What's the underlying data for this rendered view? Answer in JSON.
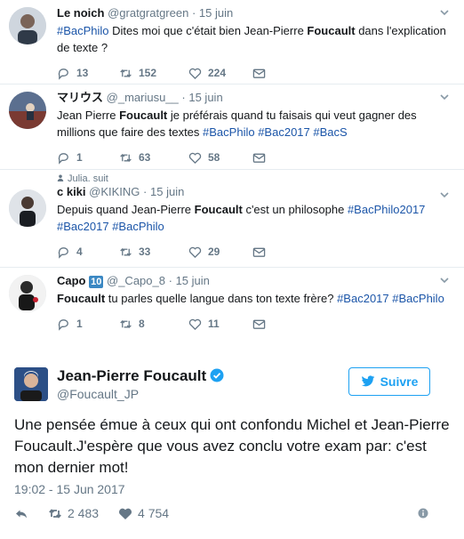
{
  "tweets": [
    {
      "name": "Le noich",
      "handle": "@gratgratgreen",
      "time": "15 juin",
      "text_parts": [
        "#BacPhilo",
        " Dites moi que c'était bien Jean-Pierre ",
        "Foucault",
        " dans l'explication de texte ?"
      ],
      "replies": "13",
      "retweets": "152",
      "likes": "224"
    },
    {
      "name": "マリウス",
      "handle": "@_mariusu__",
      "time": "15 juin",
      "text_parts": [
        "Jean Pierre ",
        "Foucault",
        " je préférais quand tu faisais qui veut gagner des millions que faire des textes ",
        "#BacPhilo",
        " ",
        "#Bac2017",
        " ",
        "#BacS"
      ],
      "replies": "1",
      "retweets": "63",
      "likes": "58"
    },
    {
      "context": "Julia. suit",
      "name": "c kiki",
      "handle": "@KIKING",
      "time": "15 juin",
      "text_parts": [
        "Depuis quand Jean-Pierre ",
        "Foucault",
        " c'est un philosophe ",
        "#BacPhilo2017",
        " ",
        "#Bac2017",
        " ",
        "#BacPhilo"
      ],
      "replies": "4",
      "retweets": "33",
      "likes": "29"
    },
    {
      "name": "Capo",
      "name_badge": "10",
      "handle": "@_Capo_8",
      "time": "15 juin",
      "text_parts": [
        "Foucault",
        " tu parles quelle langue dans ton texte frère? ",
        "#Bac2017",
        " ",
        "#BacPhilo"
      ],
      "replies": "1",
      "retweets": "8",
      "likes": "11"
    }
  ],
  "separator": "·",
  "embed": {
    "name": "Jean-Pierre Foucault",
    "handle": "@Foucault_JP",
    "follow_label": "Suivre",
    "text": "Une pensée émue à ceux qui ont confondu Michel et Jean-Pierre Foucault.J'espère que vous avez conclu votre exam par: c'est mon dernier mot!",
    "date": "19:02 - 15 Jun 2017",
    "retweets": "2 483",
    "likes": "4 754"
  },
  "colors": {
    "hashtag": "#1b55a8",
    "brand": "#1da1f2",
    "muted": "#657786"
  },
  "icons": [
    "reply-icon",
    "retweet-icon",
    "like-icon",
    "dm-icon",
    "chevron-down-icon",
    "verified-icon",
    "twitter-bird-icon",
    "info-icon"
  ]
}
